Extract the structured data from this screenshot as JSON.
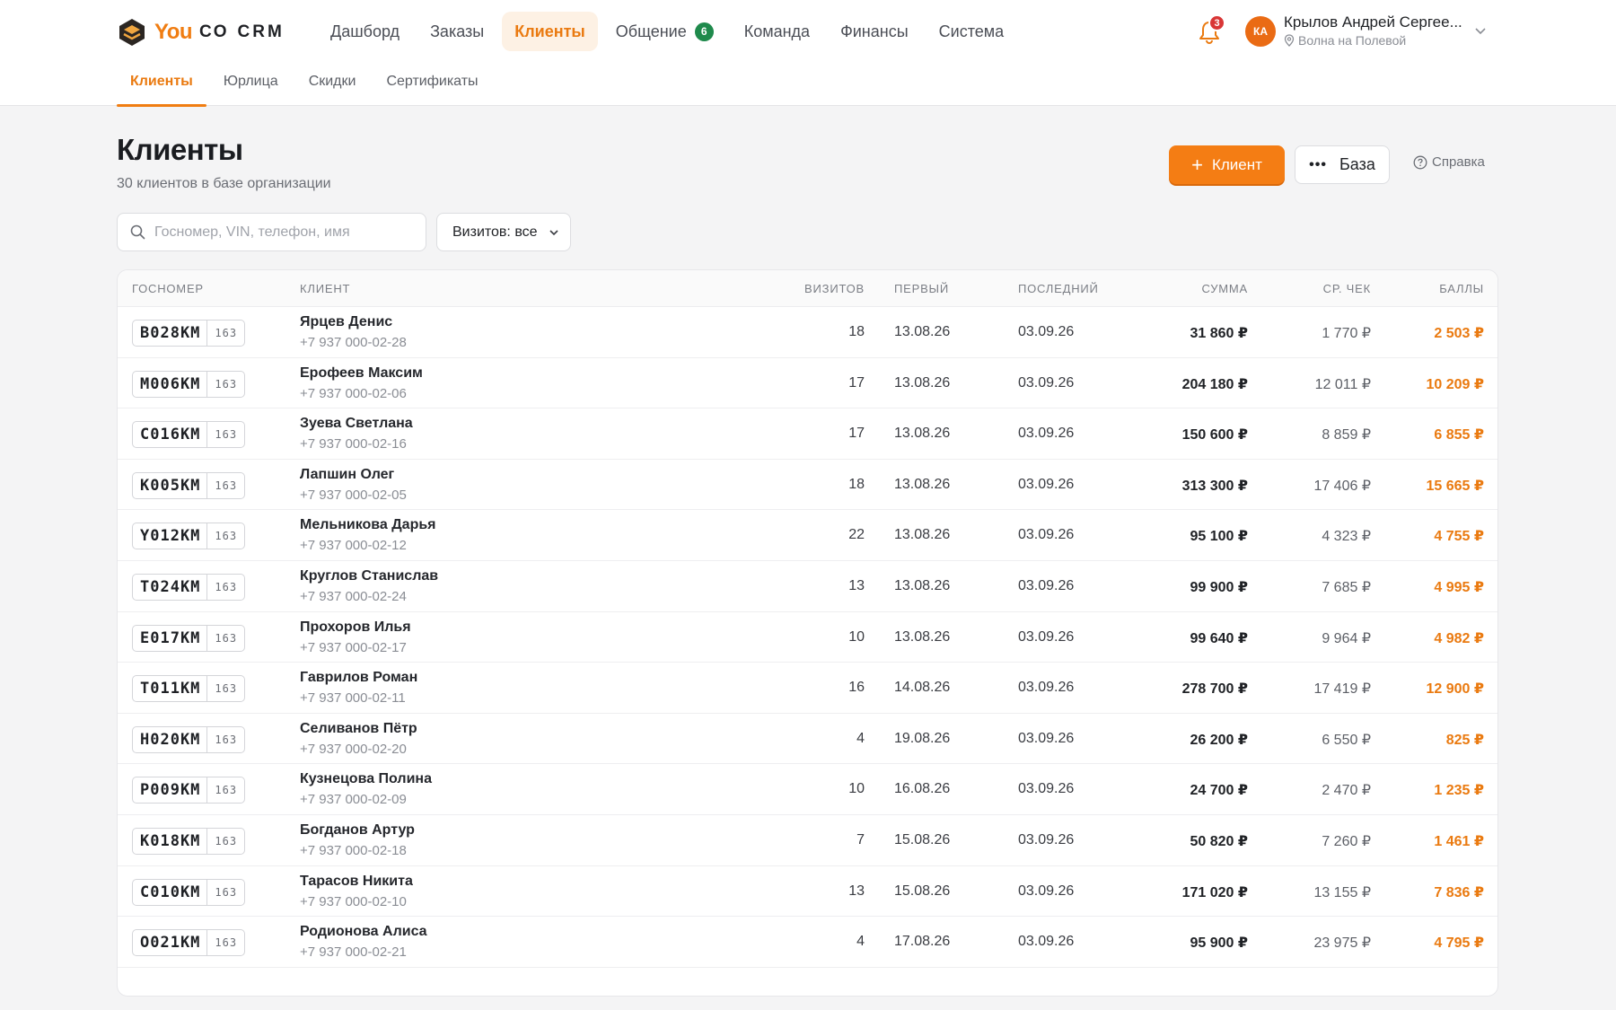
{
  "app": {
    "logo_you": "You",
    "logo_co": "CO",
    "logo_crm": "CRM"
  },
  "nav": {
    "items": [
      {
        "label": "Дашборд"
      },
      {
        "label": "Заказы"
      },
      {
        "label": "Клиенты"
      },
      {
        "label": "Общение",
        "badge": "6"
      },
      {
        "label": "Команда"
      },
      {
        "label": "Финансы"
      },
      {
        "label": "Система"
      }
    ],
    "active": "Клиенты"
  },
  "notifications": {
    "count": "3"
  },
  "user": {
    "initials": "КА",
    "name": "Крылов Андрей Сергее...",
    "location": "Волна на Полевой"
  },
  "subnav": {
    "items": [
      {
        "label": "Клиенты"
      },
      {
        "label": "Юрлица"
      },
      {
        "label": "Скидки"
      },
      {
        "label": "Сертификаты"
      }
    ]
  },
  "page": {
    "title": "Клиенты",
    "subtitle": "30 клиентов в базе организации"
  },
  "actions": {
    "add_client": "Клиент",
    "base": "База",
    "help": "Справка"
  },
  "filters": {
    "search_placeholder": "Госномер, VIN, телефон, имя",
    "visits_select": "Визитов: все"
  },
  "table": {
    "headers": {
      "plate": "Госномер",
      "client": "Клиент",
      "visits": "Визитов",
      "first": "Первый",
      "last": "Последний",
      "sum": "Сумма",
      "avg": "Ср. чек",
      "points": "Баллы"
    },
    "rows": [
      {
        "plate": "B028KM",
        "region": "163",
        "name": "Ярцев Денис",
        "phone": "+7 937 000-02-28",
        "visits": "18",
        "first": "13.08.26",
        "last": "03.09.26",
        "sum": "31 860 ₽",
        "avg": "1 770 ₽",
        "points": "2 503 ₽"
      },
      {
        "plate": "M006KM",
        "region": "163",
        "name": "Ерофеев Максим",
        "phone": "+7 937 000-02-06",
        "visits": "17",
        "first": "13.08.26",
        "last": "03.09.26",
        "sum": "204 180 ₽",
        "avg": "12 011 ₽",
        "points": "10 209 ₽"
      },
      {
        "plate": "C016KM",
        "region": "163",
        "name": "Зуева Светлана",
        "phone": "+7 937 000-02-16",
        "visits": "17",
        "first": "13.08.26",
        "last": "03.09.26",
        "sum": "150 600 ₽",
        "avg": "8 859 ₽",
        "points": "6 855 ₽"
      },
      {
        "plate": "K005KM",
        "region": "163",
        "name": "Лапшин Олег",
        "phone": "+7 937 000-02-05",
        "visits": "18",
        "first": "13.08.26",
        "last": "03.09.26",
        "sum": "313 300 ₽",
        "avg": "17 406 ₽",
        "points": "15 665 ₽"
      },
      {
        "plate": "Y012KM",
        "region": "163",
        "name": "Мельникова Дарья",
        "phone": "+7 937 000-02-12",
        "visits": "22",
        "first": "13.08.26",
        "last": "03.09.26",
        "sum": "95 100 ₽",
        "avg": "4 323 ₽",
        "points": "4 755 ₽"
      },
      {
        "plate": "T024KM",
        "region": "163",
        "name": "Круглов Станислав",
        "phone": "+7 937 000-02-24",
        "visits": "13",
        "first": "13.08.26",
        "last": "03.09.26",
        "sum": "99 900 ₽",
        "avg": "7 685 ₽",
        "points": "4 995 ₽"
      },
      {
        "plate": "E017KM",
        "region": "163",
        "name": "Прохоров Илья",
        "phone": "+7 937 000-02-17",
        "visits": "10",
        "first": "13.08.26",
        "last": "03.09.26",
        "sum": "99 640 ₽",
        "avg": "9 964 ₽",
        "points": "4 982 ₽"
      },
      {
        "plate": "T011KM",
        "region": "163",
        "name": "Гаврилов Роман",
        "phone": "+7 937 000-02-11",
        "visits": "16",
        "first": "14.08.26",
        "last": "03.09.26",
        "sum": "278 700 ₽",
        "avg": "17 419 ₽",
        "points": "12 900 ₽"
      },
      {
        "plate": "H020KM",
        "region": "163",
        "name": "Селиванов Пётр",
        "phone": "+7 937 000-02-20",
        "visits": "4",
        "first": "19.08.26",
        "last": "03.09.26",
        "sum": "26 200 ₽",
        "avg": "6 550 ₽",
        "points": "825 ₽"
      },
      {
        "plate": "P009KM",
        "region": "163",
        "name": "Кузнецова Полина",
        "phone": "+7 937 000-02-09",
        "visits": "10",
        "first": "16.08.26",
        "last": "03.09.26",
        "sum": "24 700 ₽",
        "avg": "2 470 ₽",
        "points": "1 235 ₽"
      },
      {
        "plate": "K018KM",
        "region": "163",
        "name": "Богданов Артур",
        "phone": "+7 937 000-02-18",
        "visits": "7",
        "first": "15.08.26",
        "last": "03.09.26",
        "sum": "50 820 ₽",
        "avg": "7 260 ₽",
        "points": "1 461 ₽"
      },
      {
        "plate": "C010KM",
        "region": "163",
        "name": "Тарасов Никита",
        "phone": "+7 937 000-02-10",
        "visits": "13",
        "first": "15.08.26",
        "last": "03.09.26",
        "sum": "171 020 ₽",
        "avg": "13 155 ₽",
        "points": "7 836 ₽"
      },
      {
        "plate": "O021KM",
        "region": "163",
        "name": "Родионова Алиса",
        "phone": "+7 937 000-02-21",
        "visits": "4",
        "first": "17.08.26",
        "last": "03.09.26",
        "sum": "95 900 ₽",
        "avg": "23 975 ₽",
        "points": "4 795 ₽"
      }
    ]
  },
  "colors": {
    "accent": "#f47d14",
    "points": "#ea7a10",
    "badge_green": "#1f8a4c",
    "badge_red": "#d93636"
  }
}
